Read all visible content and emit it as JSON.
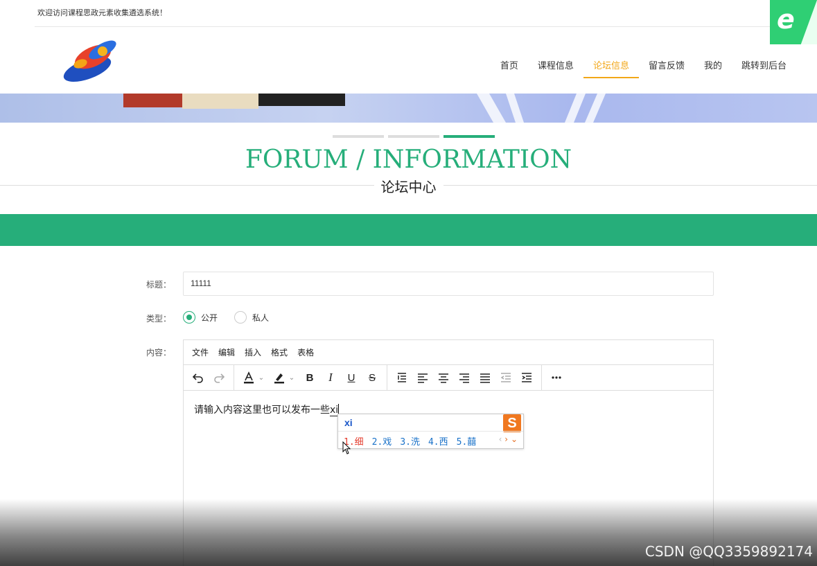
{
  "header": {
    "welcome": "欢迎访问课程思政元素收集遴选系统！"
  },
  "nav": {
    "items": [
      {
        "label": "首页",
        "active": false
      },
      {
        "label": "课程信息",
        "active": false
      },
      {
        "label": "论坛信息",
        "active": true
      },
      {
        "label": "留言反馈",
        "active": false
      },
      {
        "label": "我的",
        "active": false
      },
      {
        "label": "跳转到后台",
        "active": false
      }
    ],
    "active_color": "#f2a718"
  },
  "section": {
    "title_en": "FORUM / INFORMATION",
    "title_cn": "论坛中心",
    "accent_color": "#26ae7a"
  },
  "form": {
    "title_label": "标题：",
    "title_value": "11111",
    "type_label": "类型：",
    "type_options": [
      {
        "label": "公开",
        "checked": true
      },
      {
        "label": "私人",
        "checked": false
      }
    ],
    "content_label": "内容："
  },
  "editor": {
    "menu": [
      "文件",
      "编辑",
      "插入",
      "格式",
      "表格"
    ],
    "toolbar_icons": [
      "undo-icon",
      "redo-icon",
      "text-color-icon",
      "highlight-icon",
      "bold-icon",
      "italic-icon",
      "underline-icon",
      "strikethrough-icon",
      "line-height-icon",
      "align-left-icon",
      "align-center-icon",
      "align-right-icon",
      "align-justify-icon",
      "outdent-icon",
      "indent-icon",
      "more-icon"
    ],
    "content_text": "请输入内容这里也可以发布一些",
    "composing_text": "xi"
  },
  "ime": {
    "input": "xi",
    "candidates": [
      "1.细",
      "2.戏",
      "3.洗",
      "4.西",
      "5.囍"
    ],
    "logo": "S"
  },
  "watermark": "CSDN @QQ3359892174"
}
